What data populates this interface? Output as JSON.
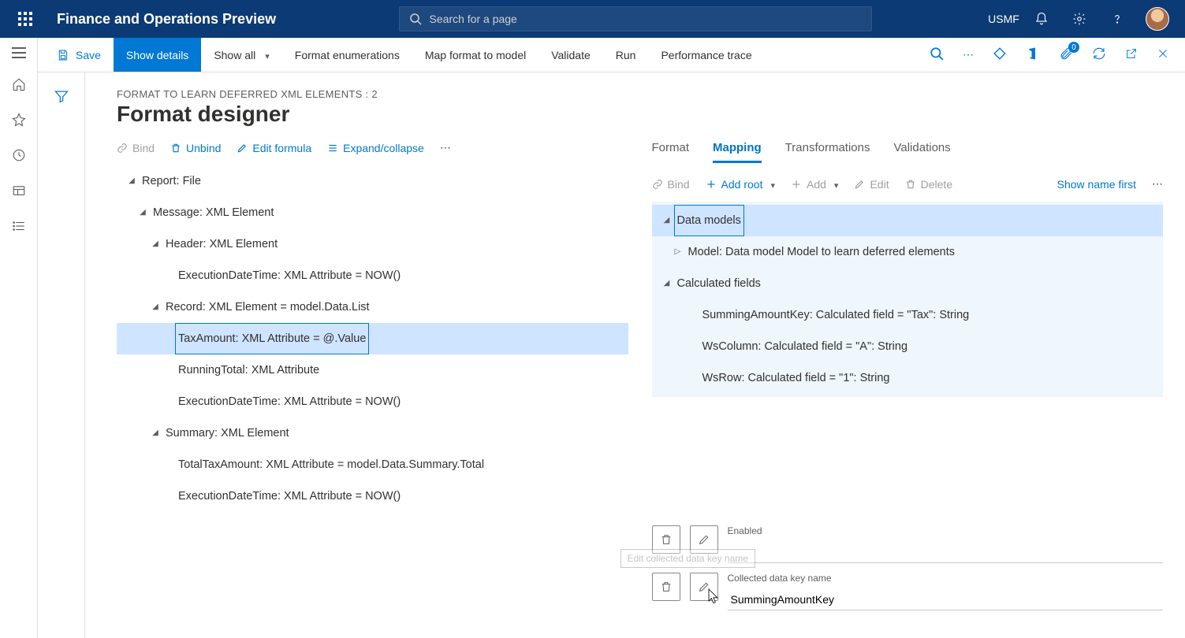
{
  "topbar": {
    "app_title": "Finance and Operations Preview",
    "search_placeholder": "Search for a page",
    "company": "USMF"
  },
  "cmdbar": {
    "save": "Save",
    "show_details": "Show details",
    "show_all": "Show all",
    "format_enum": "Format enumerations",
    "map_format": "Map format to model",
    "validate": "Validate",
    "run": "Run",
    "perf_trace": "Performance trace",
    "attach_badge": "0"
  },
  "page": {
    "breadcrumb": "FORMAT TO LEARN DEFERRED XML ELEMENTS : 2",
    "title": "Format designer"
  },
  "left_toolbar": {
    "bind": "Bind",
    "unbind": "Unbind",
    "edit_formula": "Edit formula",
    "expand_collapse": "Expand/collapse"
  },
  "format_tree": {
    "root": "Report: File",
    "message": "Message: XML Element",
    "header": "Header: XML Element",
    "header_exec": "ExecutionDateTime: XML Attribute = NOW()",
    "record": "Record: XML Element = model.Data.List",
    "tax_amount": "TaxAmount: XML Attribute = @.Value",
    "running_total": "RunningTotal: XML Attribute",
    "record_exec": "ExecutionDateTime: XML Attribute = NOW()",
    "summary": "Summary: XML Element",
    "total_tax": "TotalTaxAmount: XML Attribute = model.Data.Summary.Total",
    "summary_exec": "ExecutionDateTime: XML Attribute = NOW()"
  },
  "tabs": {
    "format": "Format",
    "mapping": "Mapping",
    "transformations": "Transformations",
    "validations": "Validations"
  },
  "right_toolbar": {
    "bind": "Bind",
    "add_root": "Add root",
    "add": "Add",
    "edit": "Edit",
    "delete": "Delete",
    "show_name_first": "Show name first"
  },
  "mapping_tree": {
    "data_models": "Data models",
    "model": "Model: Data model Model to learn deferred elements",
    "calc_fields": "Calculated fields",
    "calc_1": "SummingAmountKey: Calculated field = \"Tax\": String",
    "calc_2": "WsColumn: Calculated field = \"A\": String",
    "calc_3": "WsRow: Calculated field = \"1\": String"
  },
  "props": {
    "enabled_label": "Enabled",
    "enabled_value": "",
    "key_name_label": "Collected data key name",
    "key_name_value": "SummingAmountKey",
    "tooltip": "Edit collected data key name"
  }
}
